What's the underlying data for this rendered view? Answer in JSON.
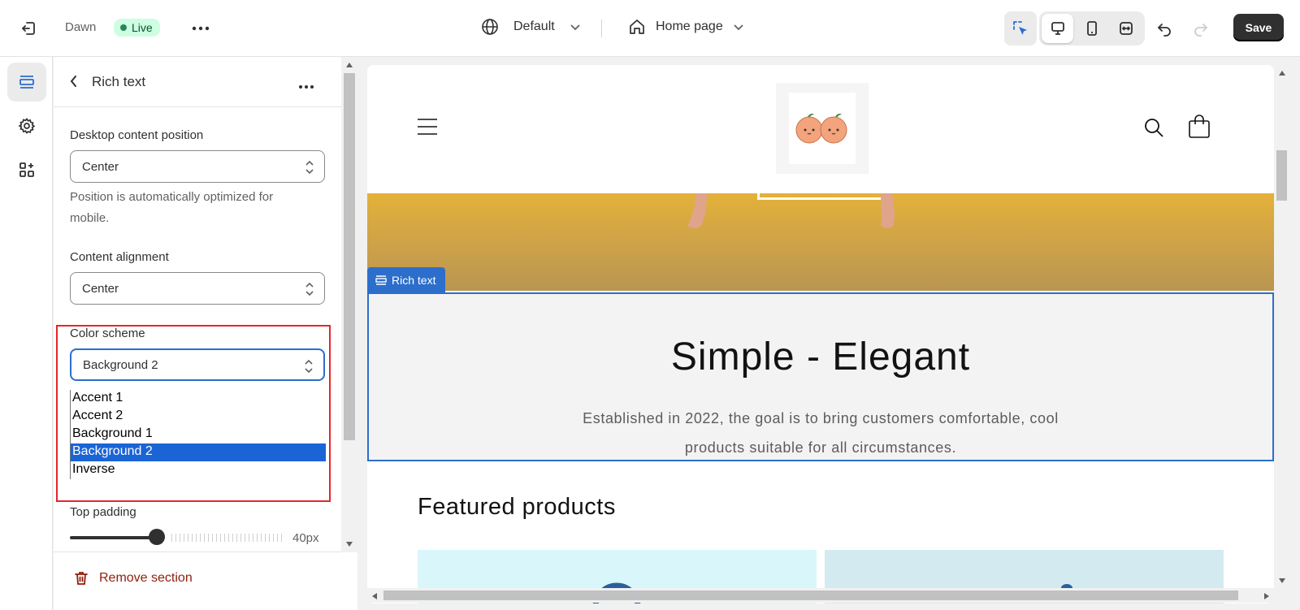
{
  "topbar": {
    "theme_name": "Dawn",
    "status_badge": "Live",
    "template_select": "Default",
    "page_select": "Home page",
    "save_label": "Save"
  },
  "panel": {
    "title": "Rich text",
    "desktop_position": {
      "label": "Desktop content position",
      "value": "Center",
      "help": "Position is automatically optimized for mobile."
    },
    "content_alignment": {
      "label": "Content alignment",
      "value": "Center"
    },
    "color_scheme": {
      "label": "Color scheme",
      "value": "Background 2",
      "options": [
        "Accent 1",
        "Accent 2",
        "Background 1",
        "Background 2",
        "Inverse"
      ],
      "selected_index": 3
    },
    "top_padding": {
      "label": "Top padding",
      "value_text": "40px",
      "fraction": 0.4
    },
    "remove_label": "Remove section"
  },
  "preview": {
    "section_tag": "Rich text",
    "heading": "Simple - Elegant",
    "body": "Established in 2022, the goal is to bring customers comfortable, cool products suitable for all circumstances.",
    "featured_title": "Featured products"
  },
  "colors": {
    "accent_blue": "#2c6ecb",
    "highlight_red": "#e5262b",
    "live_green": "#cdfee1",
    "danger": "#8e1f0b"
  }
}
